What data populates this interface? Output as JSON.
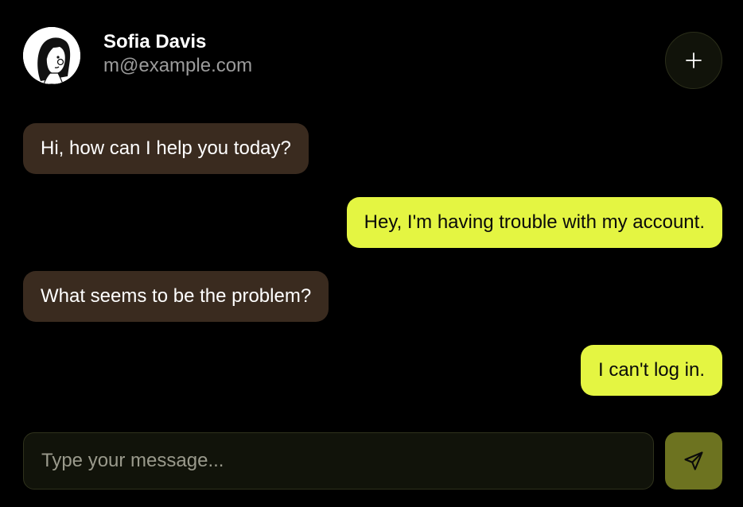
{
  "header": {
    "user_name": "Sofia Davis",
    "user_email": "m@example.com",
    "new_chat_icon": "plus-icon"
  },
  "messages": [
    {
      "sender": "agent",
      "text": "Hi, how can I help you today?"
    },
    {
      "sender": "user",
      "text": "Hey, I'm having trouble with my account."
    },
    {
      "sender": "agent",
      "text": "What seems to be the problem?"
    },
    {
      "sender": "user",
      "text": "I can't log in."
    }
  ],
  "composer": {
    "placeholder": "Type your message...",
    "value": "",
    "send_icon": "send-icon"
  },
  "colors": {
    "background": "#000000",
    "agent_bubble": "#3a2b1f",
    "user_bubble": "#e4f542",
    "send_button": "#6d7320"
  }
}
